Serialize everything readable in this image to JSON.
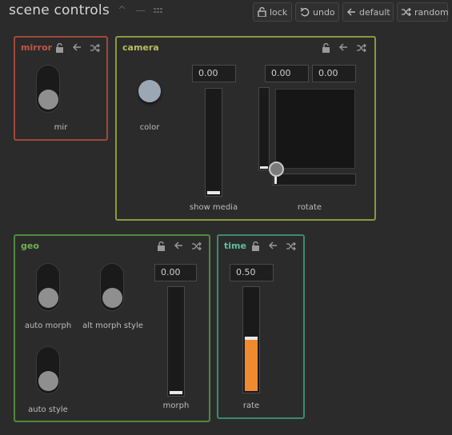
{
  "header": {
    "title": "scene controls",
    "buttons": {
      "lock": "lock",
      "undo": "undo",
      "default": "default",
      "random": "random"
    }
  },
  "colors": {
    "mirror": "#a0483c",
    "camera": "#8a9a3c",
    "geo": "#4f8a3c",
    "time": "#3c8a6e",
    "rate_fill": "#f08a30"
  },
  "panels": {
    "mirror": {
      "title": "mirror",
      "toggle": {
        "label": "mir",
        "on": false
      }
    },
    "camera": {
      "title": "camera",
      "knob": {
        "label": "color"
      },
      "show_media": {
        "label": "show media",
        "value": "0.00",
        "level": 0.0
      },
      "rotate": {
        "label": "rotate",
        "x": "0.00",
        "y": "0.00"
      }
    },
    "geo": {
      "title": "geo",
      "toggles": [
        {
          "label": "auto morph",
          "on": false
        },
        {
          "label": "alt morph style",
          "on": false
        },
        {
          "label": "auto style",
          "on": false
        }
      ],
      "morph": {
        "label": "morph",
        "value": "0.00",
        "level": 0.0
      }
    },
    "time": {
      "title": "time",
      "rate": {
        "label": "rate",
        "value": "0.50",
        "level": 0.5
      }
    }
  }
}
